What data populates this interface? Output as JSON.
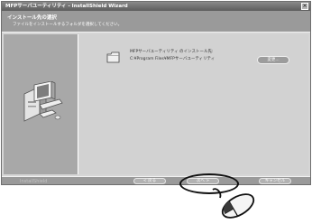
{
  "window": {
    "title": "MFPサーバユーティリティ - InstallShield Wizard",
    "close_label": "×"
  },
  "header": {
    "title": "インストール先の選択",
    "subtitle": "ファイルをインストールするフォルダを選択してください。"
  },
  "content": {
    "install_to_label": "MFPサーバユーティリティ のインストール先:",
    "install_path": "C:¥Program Files¥MFPサーバユーティリティ",
    "change_button": "変更..."
  },
  "footer": {
    "brand": "InstallShield",
    "back_button": "< 戻る",
    "next_button": "次へ >",
    "cancel_button": "キャンセル"
  }
}
